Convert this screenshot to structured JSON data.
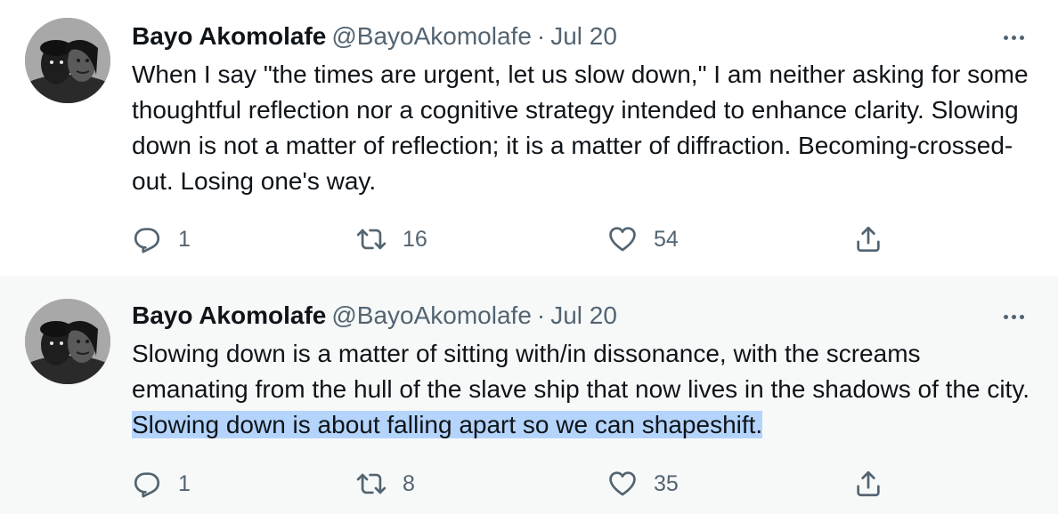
{
  "tweets": [
    {
      "author_name": "Bayo Akomolafe",
      "handle": "@BayoAkomolafe",
      "separator": "·",
      "date": "Jul 20",
      "text": "When I say \"the times are urgent, let us slow down,\" I am neither asking for some thoughtful reflection nor a cognitive strategy intended to enhance clarity. Slowing down is not a matter of reflection; it is a matter of diffraction. Becoming-crossed-out. Losing one's way.",
      "replies": "1",
      "retweets": "16",
      "likes": "54"
    },
    {
      "author_name": "Bayo Akomolafe",
      "handle": "@BayoAkomolafe",
      "separator": "·",
      "date": "Jul 20",
      "text_plain": "Slowing down is a matter of sitting with/in dissonance, with the screams emanating from the hull of the slave ship that now lives in the shadows of the city. ",
      "text_highlighted": "Slowing down is about falling apart so we can shapeshift.",
      "replies": "1",
      "retweets": "8",
      "likes": "35"
    }
  ],
  "icons": {
    "more": "more-horizontal-icon",
    "reply": "reply-icon",
    "retweet": "retweet-icon",
    "like": "heart-icon",
    "share": "share-icon"
  },
  "colors": {
    "text_primary": "#0f1419",
    "text_secondary": "#536471",
    "selection_highlight": "#b4d4fb",
    "second_tweet_background": "#f7f9f9",
    "thread_line": "#cfd9de"
  }
}
